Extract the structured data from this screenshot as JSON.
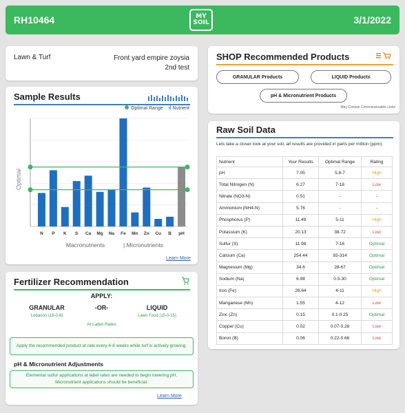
{
  "header": {
    "report_id": "RH10464",
    "date": "3/1/2022",
    "logo_line1": "MY",
    "logo_line2": "SOIL"
  },
  "info": {
    "category": "Lawn & Turf",
    "sample_name": "Front yard empire zoysia",
    "sample_sub": "2nd test"
  },
  "shop": {
    "title": "SHOP Recommended Products",
    "buttons": [
      "GRANULAR Products",
      "LIQUID Products",
      "pH & Micronutrient Products"
    ],
    "disclaimer": "May Contain Commissionable Links"
  },
  "sample": {
    "title": "Sample Results",
    "legend_optimal": "Optimal Range",
    "legend_nutrient": "Nutrient",
    "learn_more": "Learn More"
  },
  "chart_data": {
    "type": "bar",
    "categories": [
      "N",
      "P",
      "K",
      "S",
      "Ca",
      "Mg",
      "Na",
      "Fe",
      "Mn",
      "Zn",
      "Cu",
      "B",
      "pH"
    ],
    "values": [
      31,
      52,
      18,
      42,
      47,
      32,
      34,
      100,
      13,
      36,
      7,
      9,
      55
    ],
    "optimal_lines": [
      34,
      55
    ],
    "ylabel": "Optimal",
    "xlabel_macro": "Macronutrients",
    "xlabel_micro": "| Micronutrients",
    "ylim": [
      0,
      100
    ],
    "colors": {
      "bar": "#1f6fbf",
      "ph_bar": "#8c8c8c",
      "optimal": "#3cb85f"
    }
  },
  "fertilizer": {
    "title": "Fertilizer Recommendation",
    "apply": "APPLY:",
    "granular": "GRANULAR",
    "or": "-OR-",
    "liquid": "LIQUID",
    "granular_product": "Lebanon (16-0-8)",
    "liquid_product": "Lawn Food (15-0-15)",
    "rate": "At Label Rates",
    "note": "Apply the recommended product at rate every 4-6 weeks while turf is actively growing.",
    "ph_title": "pH & Micronutrient Adjustments",
    "ph_note": "Elemental sulfur applications at label rates are needed to begin lowering pH. Micronutrient applications should be beneficial.",
    "learn_more": "Learn More"
  },
  "raw": {
    "title": "Raw Soil Data",
    "description": "Lets take a closer look at your soil, all results are provided in parts per million (ppm).",
    "columns": [
      "Nutrient",
      "Your Results",
      "Optimal Range",
      "Rating"
    ],
    "rows": [
      [
        "pH",
        "7.05",
        "5.8-7",
        "High"
      ],
      [
        "Total Nitrogen (N)",
        "6.27",
        "7-18",
        "Low"
      ],
      [
        "Nitrate (NO3-N)",
        "0.51",
        "-",
        "-"
      ],
      [
        "Ammonium (NH4-N)",
        "5.76",
        "-",
        "-"
      ],
      [
        "Phosphorus (P)",
        "11.49",
        "5-11",
        "High"
      ],
      [
        "Potassium (K)",
        "20.13",
        "38-72",
        "Low"
      ],
      [
        "Sulfur (S)",
        "11.98",
        "7-16",
        "Optimal"
      ],
      [
        "Calcium (Ca)",
        "254.44",
        "93-314",
        "Optimal"
      ],
      [
        "Magnesium (Mg)",
        "34.6",
        "28-67",
        "Optimal"
      ],
      [
        "Sodium (Na)",
        "6.98",
        "0.5-30",
        "Optimal"
      ],
      [
        "Iron (Fe)",
        "26.64",
        "4-11",
        "High"
      ],
      [
        "Manganese (Mn)",
        "1.55",
        "4-12",
        "Low"
      ],
      [
        "Zinc (Zn)",
        "0.15",
        "0.1-0.25",
        "Optimal"
      ],
      [
        "Copper (Cu)",
        "0.02",
        "0.07-0.28",
        "Low"
      ],
      [
        "Boron (B)",
        "0.06",
        "0.22-0.66",
        "Low"
      ]
    ]
  }
}
